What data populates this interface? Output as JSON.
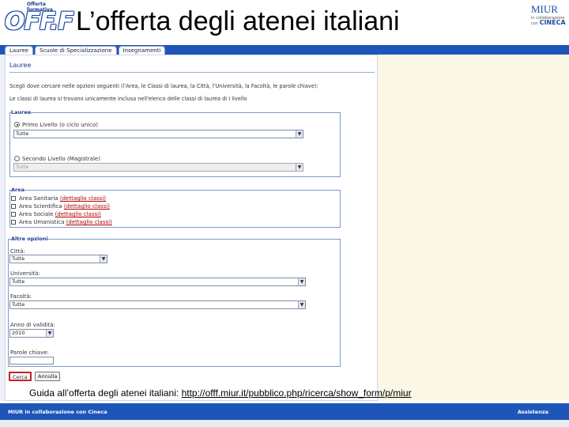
{
  "header": {
    "logo_tagline": "Offerta formativa",
    "logo_mark": "OFF.F",
    "title": "L’offerta degli atenei italiani",
    "partner_name": "MIUR",
    "partner_note_1": "in collaborazione",
    "partner_note_2": "con",
    "partner_cineca": "CINECA"
  },
  "tabs": [
    {
      "label": "Lauree",
      "active": true
    },
    {
      "label": "Scuole di Specializzazione",
      "active": false
    },
    {
      "label": "Insegnamenti",
      "active": false
    }
  ],
  "form": {
    "section_title": "Lauree",
    "instructions": "Scegli dove cercare nelle opzioni seguenti (l'Area, le Classi di laurea, la Città, l'Università, la Facoltà, le parole chiave):",
    "note": "Le classi di laurea si trovano unicamente inclusa nell'elenco delle classi di laurea di I livello",
    "lauree_legend": "Lauree",
    "radio_first_label": "Primo Livello (o ciclo unico)",
    "radio_first_value": "Tutte",
    "radio_second_label": "Secondo Livello (Magistrale)",
    "radio_second_value": "Tutte",
    "area_legend": "Area",
    "areas": [
      {
        "name": "Area Sanitaria",
        "link": "(dettaglio classi)"
      },
      {
        "name": "Area Scientifica",
        "link": "(dettaglio classi)"
      },
      {
        "name": "Area Sociale",
        "link": "(dettaglio classi)"
      },
      {
        "name": "Area Umanistica",
        "link": "(dettaglio classi)"
      }
    ],
    "other_legend": "Altre opzioni",
    "city_label": "Città:",
    "city_value": "Tutte",
    "university_label": "Università:",
    "university_value": "Tutte",
    "faculty_label": "Facoltà:",
    "faculty_value": "Tutte",
    "year_label": "Anno di validità:",
    "year_value": "2010",
    "keywords_label": "Parole chiave:",
    "search_button": "Cerca",
    "reset_button": "Annulla"
  },
  "caption": {
    "prefix": "Guida all’offerta degli atenei italiani: ",
    "url": "http://offf.miur.it/pubblico.php/ricerca/show_form/p/miur"
  },
  "footer": {
    "left": "MIUR in collaborazione con Cineca",
    "right": "Assistenza"
  },
  "colors": {
    "brand_blue": "#1d56b8",
    "link_red": "#b00000",
    "right_pane": "#fbf7e6"
  }
}
